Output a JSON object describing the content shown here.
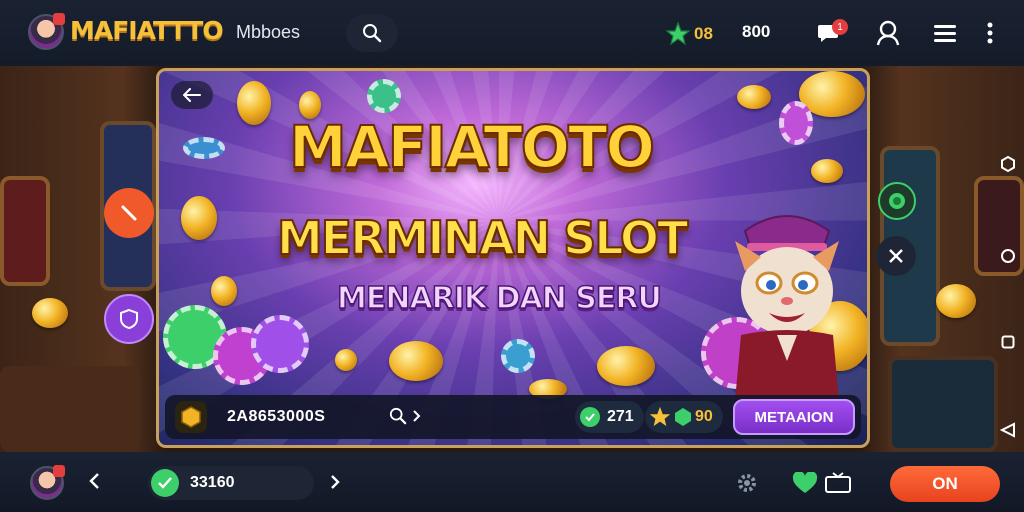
{
  "header": {
    "brand": "MAFIATTTO",
    "brand_sub": "Mbboes",
    "stat_gems": "08",
    "stat_coins": "800",
    "notification_count": "1"
  },
  "banner": {
    "title_line1": "MAFIATOTO",
    "title_line2": "MERMINAN SLOT",
    "title_line3": "MENARIK DAN SERU",
    "bar": {
      "code": "2A8653000S",
      "chip_count": "271",
      "token_count": "90",
      "action_label": "METAAION"
    }
  },
  "footer": {
    "balance": "33160",
    "on_label": "ON"
  },
  "colors": {
    "accent_gold": "#f6c03a",
    "action_purple": "#8b3fd9",
    "on_orange": "#ff5a2a",
    "gem_green": "#3ccf6a"
  }
}
